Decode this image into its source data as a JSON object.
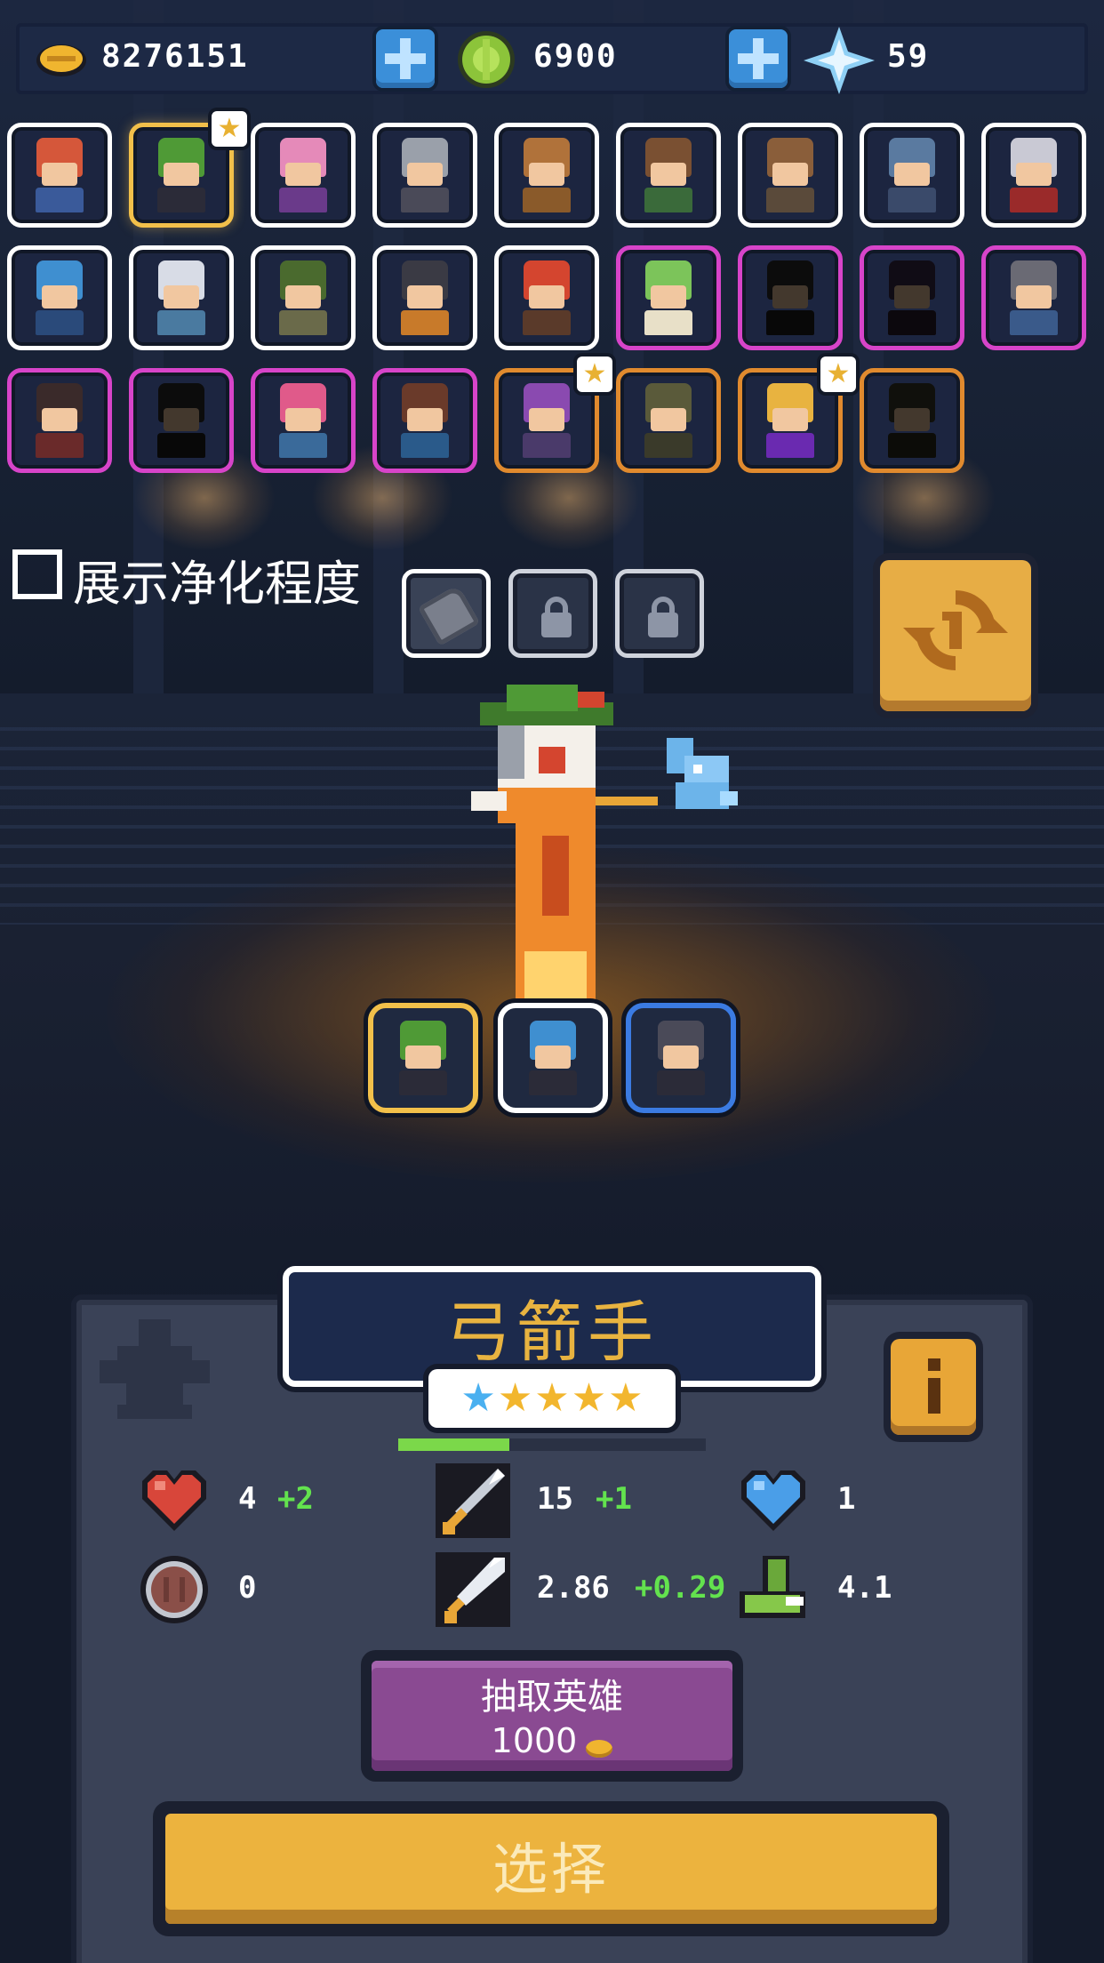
{
  "resources": {
    "gold": "8276151",
    "gems": "6900",
    "crystals": "59"
  },
  "colors": {
    "gold_accent": "#e8b340",
    "legend_rarity": "#e08a2e",
    "epic_rarity": "#d744c9",
    "selected": "#f2c04a",
    "bonus_green": "#63e24e",
    "draw_purple": "#8a4a92",
    "select_yellow": "#ecb33e"
  },
  "hero_roster": [
    {
      "icon": "red-haired-hero-icon",
      "rarity": "common"
    },
    {
      "icon": "green-hat-archer-icon",
      "rarity": "selected",
      "starred": true
    },
    {
      "icon": "pink-haired-mage-icon",
      "rarity": "common"
    },
    {
      "icon": "helmet-knight-icon",
      "rarity": "common"
    },
    {
      "icon": "bald-monk-icon",
      "rarity": "common"
    },
    {
      "icon": "masked-rogue-icon",
      "rarity": "common"
    },
    {
      "icon": "bearded-warrior-icon",
      "rarity": "common"
    },
    {
      "icon": "undead-knight-icon",
      "rarity": "common"
    },
    {
      "icon": "rabbit-warrior-icon",
      "rarity": "common"
    },
    {
      "icon": "blue-haired-hero-icon",
      "rarity": "common"
    },
    {
      "icon": "white-haired-elf-icon",
      "rarity": "common"
    },
    {
      "icon": "headband-fighter-icon",
      "rarity": "common"
    },
    {
      "icon": "dark-haired-fighter-icon",
      "rarity": "common"
    },
    {
      "icon": "horned-demon-icon",
      "rarity": "common"
    },
    {
      "icon": "green-haired-dryad-icon",
      "rarity": "epic"
    },
    {
      "icon": "locked-shadow-hero-icon",
      "rarity": "epic",
      "dim": true
    },
    {
      "icon": "locked-hooded-hero-icon",
      "rarity": "epic",
      "dim": true
    },
    {
      "icon": "grey-haired-monk-icon",
      "rarity": "epic"
    },
    {
      "icon": "cowboy-gunner-icon",
      "rarity": "epic"
    },
    {
      "icon": "locked-dark-warrior-icon",
      "rarity": "epic",
      "dim": true
    },
    {
      "icon": "pink-twintail-mage-icon",
      "rarity": "epic"
    },
    {
      "icon": "pirate-hero-icon",
      "rarity": "epic"
    },
    {
      "icon": "purple-witch-icon",
      "rarity": "legend",
      "starred": true
    },
    {
      "icon": "hooded-assassin-icon",
      "rarity": "legend"
    },
    {
      "icon": "golden-dragon-knight-icon",
      "rarity": "legend",
      "starred": true
    },
    {
      "icon": "locked-legend-hero-icon",
      "rarity": "legend",
      "dim": true
    }
  ],
  "purify": {
    "label": "展示净化程度",
    "checked": false
  },
  "equipment_slots": [
    {
      "icon": "gauntlet-icon",
      "locked": false
    },
    {
      "icon": "lock-icon",
      "locked": true
    },
    {
      "icon": "lock-icon",
      "locked": true
    }
  ],
  "team": [
    {
      "icon": "green-hat-archer-icon",
      "frame": "gold"
    },
    {
      "icon": "blue-hat-hero-icon",
      "frame": "white"
    },
    {
      "icon": "armored-knight-icon",
      "frame": "blue"
    }
  ],
  "hero": {
    "name": "弓箭手",
    "stars": [
      "blue",
      "gold",
      "gold",
      "gold",
      "gold"
    ],
    "xp_fraction": 0.36
  },
  "stats": {
    "hp": {
      "icon": "heart-icon",
      "value": "4",
      "bonus": "+2"
    },
    "attack": {
      "icon": "sword-icon",
      "value": "15",
      "bonus": "+1"
    },
    "shield": {
      "icon": "blue-heart-icon",
      "value": "1"
    },
    "armor": {
      "icon": "barrel-shield-icon",
      "value": "0"
    },
    "crit": {
      "icon": "dagger-icon",
      "value": "2.86",
      "bonus": "+0.29"
    },
    "speed": {
      "icon": "boot-icon",
      "value": "4.1"
    }
  },
  "draw_button": {
    "label": "抽取英雄",
    "cost": "1000"
  },
  "select_button": {
    "label": "选择"
  }
}
